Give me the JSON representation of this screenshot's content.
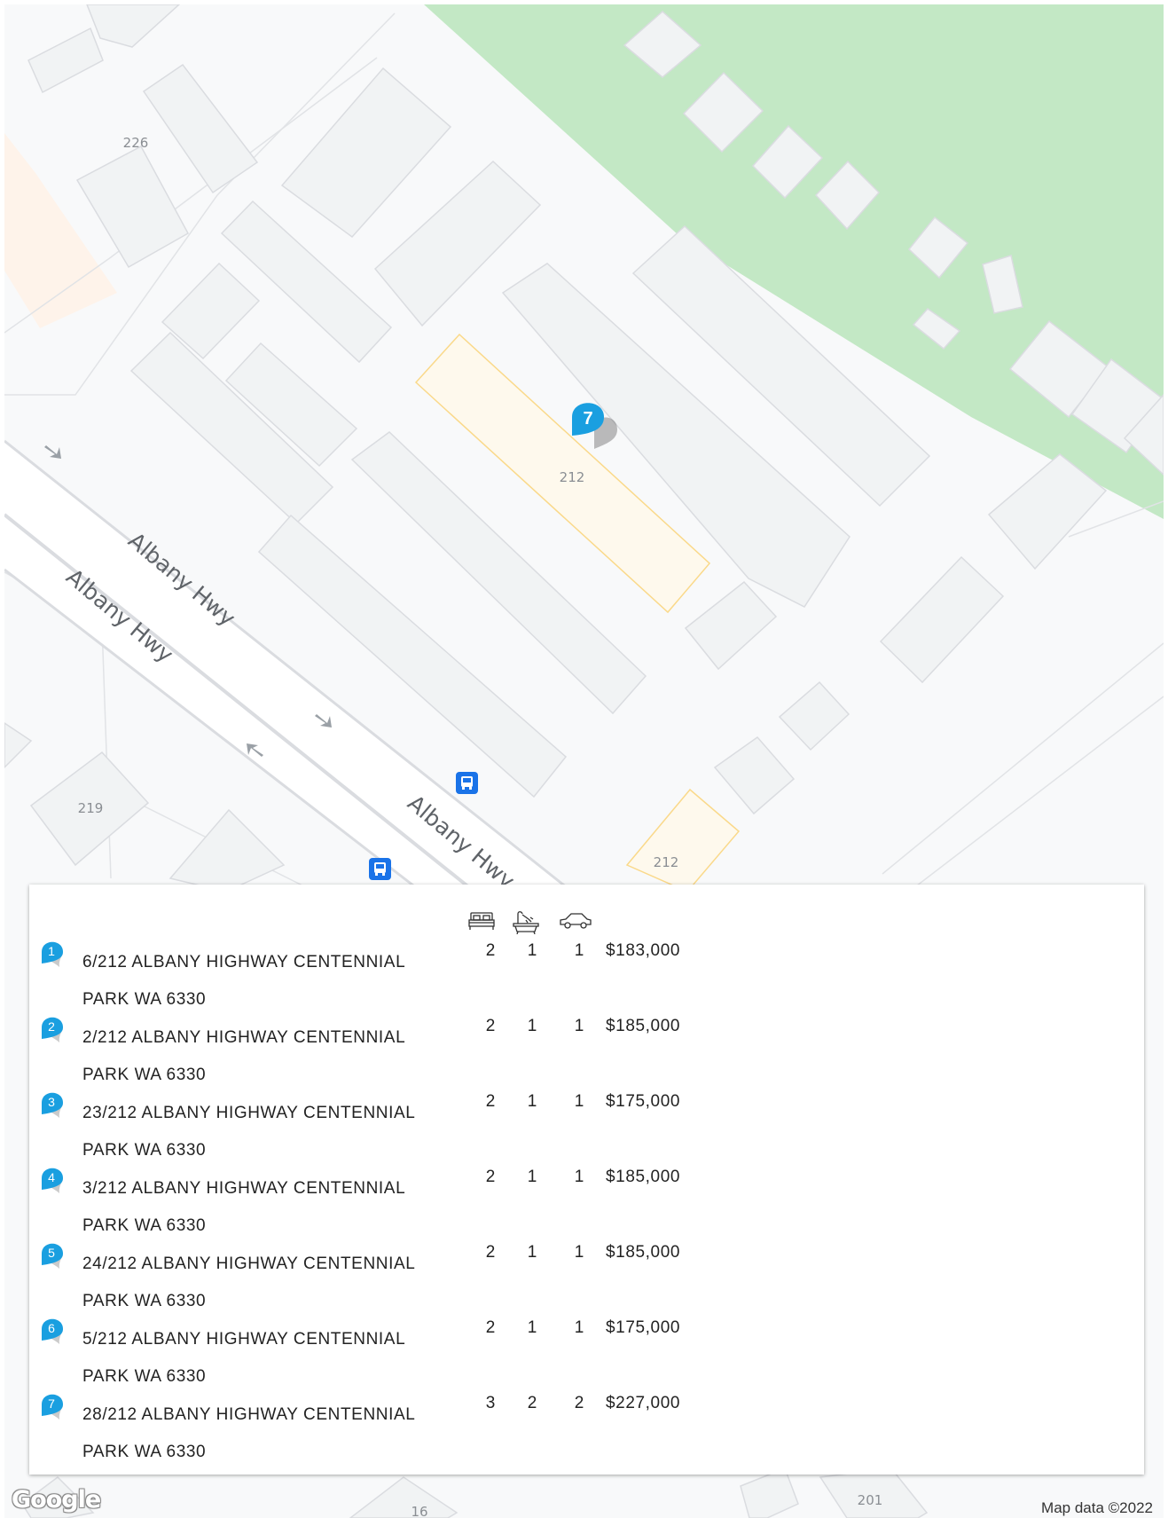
{
  "map": {
    "parcel_labels": [
      "226",
      "212",
      "219",
      "212",
      "16",
      "201"
    ],
    "road_labels": [
      "Albany Hwy",
      "Albany Hwy",
      "Albany Hwy"
    ],
    "marker_label": "7",
    "logo_text": "Google",
    "attribution": "Map data ©2022",
    "colors": {
      "park": "#c3e8c5",
      "building": "#f1f3f4",
      "highlight": "#fef9ed",
      "highlight_stroke": "#fad98a",
      "marker": "#1a9fe0",
      "bus_stop": "#1a73e8"
    },
    "icons": [
      "map-pin-icon",
      "bus-stop-icon",
      "one-way-arrow-icon"
    ]
  },
  "listing": {
    "header_icons": [
      "bed-icon",
      "bath-icon",
      "car-icon"
    ],
    "rows": [
      {
        "marker": "1",
        "address_line1": "6/212 ALBANY HIGHWAY CENTENNIAL",
        "address_line2": "PARK WA 6330",
        "beds": "2",
        "baths": "1",
        "cars": "1",
        "price": "$183,000"
      },
      {
        "marker": "2",
        "address_line1": "2/212 ALBANY HIGHWAY CENTENNIAL",
        "address_line2": "PARK WA 6330",
        "beds": "2",
        "baths": "1",
        "cars": "1",
        "price": "$185,000"
      },
      {
        "marker": "3",
        "address_line1": "23/212 ALBANY HIGHWAY CENTENNIAL",
        "address_line2": "PARK WA 6330",
        "beds": "2",
        "baths": "1",
        "cars": "1",
        "price": "$175,000"
      },
      {
        "marker": "4",
        "address_line1": "3/212 ALBANY HIGHWAY CENTENNIAL",
        "address_line2": "PARK WA 6330",
        "beds": "2",
        "baths": "1",
        "cars": "1",
        "price": "$185,000"
      },
      {
        "marker": "5",
        "address_line1": "24/212 ALBANY HIGHWAY CENTENNIAL",
        "address_line2": "PARK WA 6330",
        "beds": "2",
        "baths": "1",
        "cars": "1",
        "price": "$185,000"
      },
      {
        "marker": "6",
        "address_line1": "5/212 ALBANY HIGHWAY CENTENNIAL",
        "address_line2": "PARK WA 6330",
        "beds": "2",
        "baths": "1",
        "cars": "1",
        "price": "$175,000"
      },
      {
        "marker": "7",
        "address_line1": "28/212 ALBANY HIGHWAY CENTENNIAL",
        "address_line2": "PARK WA 6330",
        "beds": "3",
        "baths": "2",
        "cars": "2",
        "price": "$227,000"
      }
    ]
  }
}
